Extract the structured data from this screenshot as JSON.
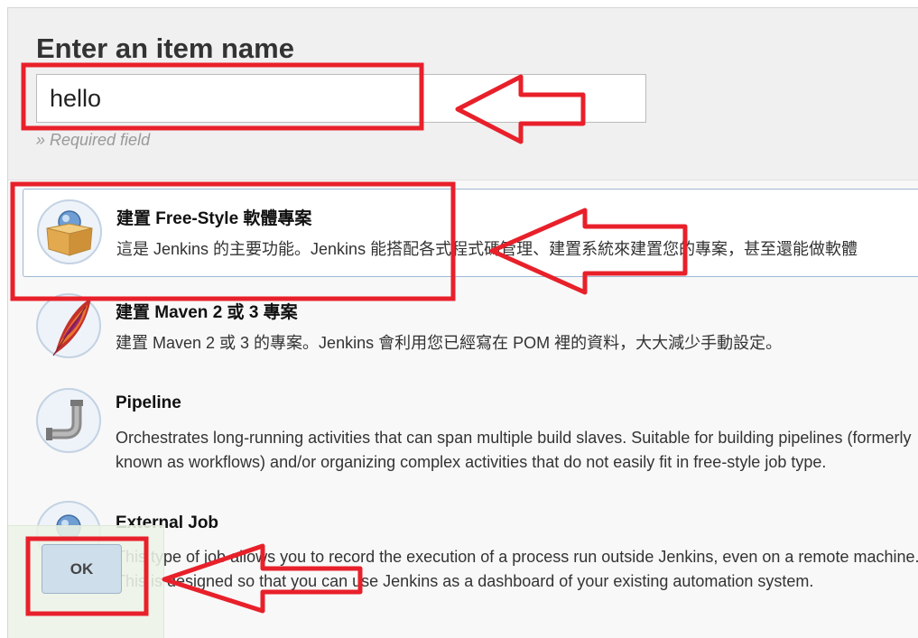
{
  "form": {
    "title": "Enter an item name",
    "item_name_value": "hello",
    "required_text": "» Required field"
  },
  "job_types": [
    {
      "title": "建置 Free-Style 軟體專案",
      "description": "這是 Jenkins 的主要功能。Jenkins 能搭配各式程式碼管理、建置系統來建置您的專案，甚至還能做軟體",
      "icon": "freestyle-box-icon",
      "selected": true
    },
    {
      "title": "建置 Maven 2 或 3 專案",
      "description": "建置 Maven 2 或 3 的專案。Jenkins 會利用您已經寫在 POM 裡的資料，大大減少手動設定。",
      "icon": "maven-feather-icon"
    },
    {
      "title": "Pipeline",
      "description": "Orchestrates long-running activities that can span multiple build slaves. Suitable for building pipelines (formerly known as workflows) and/or organizing complex activities that do not easily fit in free-style job type.",
      "icon": "pipeline-pipe-icon"
    },
    {
      "title": "External Job",
      "description": "This type of job allows you to record the execution of a process run outside Jenkins, even on a remote machine. This is designed so that you can use Jenkins as a dashboard of your existing automation system.",
      "icon": "external-job-icon"
    }
  ],
  "footer": {
    "ok_label": "OK"
  },
  "annotations": {
    "color": "#e8202a"
  },
  "colors": {
    "selected_border": "#9fb7d3",
    "ok_button_bg": "#cfdeeb"
  }
}
